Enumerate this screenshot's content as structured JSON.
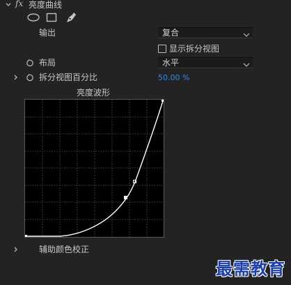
{
  "effect": {
    "fx_label": "fx",
    "title": "亮度曲线"
  },
  "output": {
    "label": "输出",
    "value": "复合"
  },
  "split_view": {
    "label": "显示拆分视图",
    "checked": false
  },
  "layout": {
    "label": "布局",
    "value": "水平"
  },
  "split_percent": {
    "label": "拆分视图百分比",
    "value": "50.00 %"
  },
  "graph": {
    "title": "亮度波形"
  },
  "secondary": {
    "label": "辅助颜色校正"
  },
  "watermark": {
    "text": "最需教育"
  },
  "colors": {
    "background": "#232323",
    "accent": "#2d8ceb",
    "watermark": "#1e3fa6"
  },
  "icons": [
    "chevron-down-icon",
    "ellipse-mask-icon",
    "rectangle-mask-icon",
    "pen-mask-icon",
    "reset-icon",
    "chevron-right-icon"
  ]
}
